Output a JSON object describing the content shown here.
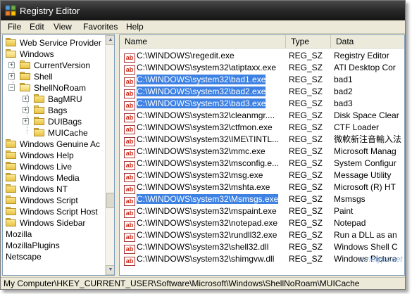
{
  "window": {
    "title": "Registry Editor"
  },
  "menu": [
    "File",
    "Edit",
    "View",
    "Favorites",
    "Help"
  ],
  "tree": {
    "items": [
      "Web Service Provider",
      "Windows",
      "CurrentVersion",
      "Shell",
      "ShellNoRoam",
      "BagMRU",
      "Bags",
      "DUIBags",
      "MUICache",
      "Windows Genuine Ac",
      "Windows Help",
      "Windows Live",
      "Windows Media",
      "Windows NT",
      "Windows Script",
      "Windows Script Host",
      "Windows Sidebar",
      "Mozilla",
      "MozillaPlugins",
      "Netscape"
    ]
  },
  "list": {
    "columns": [
      "Name",
      "Type",
      "Data"
    ],
    "rows": [
      {
        "name": "C:\\WINDOWS\\regedit.exe",
        "type": "REG_SZ",
        "data": "Registry Editor"
      },
      {
        "name": "C:\\WINDOWS\\system32\\atiptaxx.exe",
        "type": "REG_SZ",
        "data": "ATI Desktop Cor"
      },
      {
        "name": "C:\\WINDOWS\\system32\\bad1.exe",
        "type": "REG_SZ",
        "data": "bad1"
      },
      {
        "name": "C:\\WINDOWS\\system32\\bad2.exe",
        "type": "REG_SZ",
        "data": "bad2"
      },
      {
        "name": "C:\\WINDOWS\\system32\\bad3.exe",
        "type": "REG_SZ",
        "data": "bad3"
      },
      {
        "name": "C:\\WINDOWS\\system32\\cleanmgr....",
        "type": "REG_SZ",
        "data": "Disk Space Clear"
      },
      {
        "name": "C:\\WINDOWS\\system32\\ctfmon.exe",
        "type": "REG_SZ",
        "data": "CTF Loader"
      },
      {
        "name": "C:\\WINDOWS\\system32\\IME\\TINTL...",
        "type": "REG_SZ",
        "data": "微軟新注音輸入法"
      },
      {
        "name": "C:\\WINDOWS\\system32\\mmc.exe",
        "type": "REG_SZ",
        "data": "Microsoft Manag"
      },
      {
        "name": "C:\\WINDOWS\\system32\\msconfig.e...",
        "type": "REG_SZ",
        "data": "System Configur"
      },
      {
        "name": "C:\\WINDOWS\\system32\\msg.exe",
        "type": "REG_SZ",
        "data": "Message Utility"
      },
      {
        "name": "C:\\WINDOWS\\system32\\mshta.exe",
        "type": "REG_SZ",
        "data": "Microsoft (R) HT"
      },
      {
        "name": "C:\\WINDOWS\\system32\\Msmsgs.exe",
        "type": "REG_SZ",
        "data": "Msmsgs"
      },
      {
        "name": "C:\\WINDOWS\\system32\\mspaint.exe",
        "type": "REG_SZ",
        "data": "Paint"
      },
      {
        "name": "C:\\WINDOWS\\system32\\notepad.exe",
        "type": "REG_SZ",
        "data": "Notepad"
      },
      {
        "name": "C:\\WINDOWS\\system32\\rundll32.exe",
        "type": "REG_SZ",
        "data": "Run a DLL as an"
      },
      {
        "name": "C:\\WINDOWS\\system32\\shell32.dll",
        "type": "REG_SZ",
        "data": "Windows Shell C"
      },
      {
        "name": "C:\\WINDOWS\\system32\\shimgvw.dll",
        "type": "REG_SZ",
        "data": "Windows Picture"
      }
    ],
    "value_icon": "ab"
  },
  "statusbar": {
    "path": "My Computer\\HKEY_CURRENT_USER\\Software\\Microsoft\\Windows\\ShellNoRoam\\MUICache"
  },
  "watermark": "varietypc.net",
  "colors": {
    "selection": "#3d81e3",
    "titlebar": "#2b2b2b"
  }
}
